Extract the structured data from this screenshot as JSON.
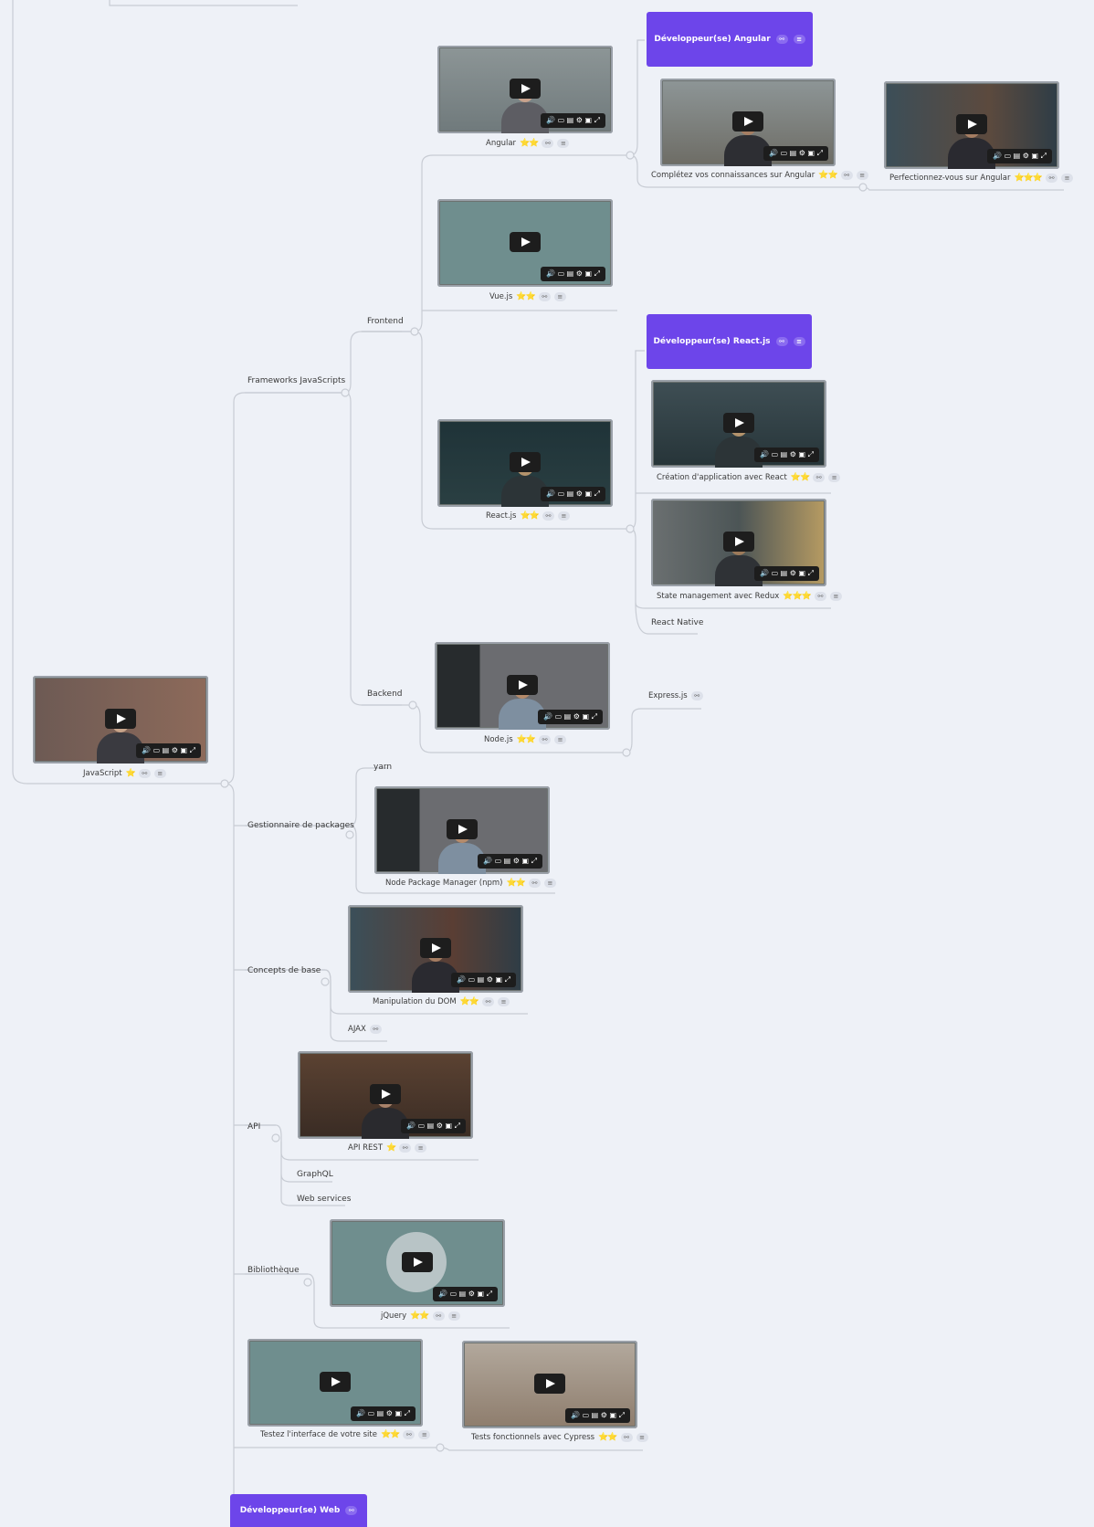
{
  "colors": {
    "accent": "#6d45ea",
    "edge": "#c8ccd4",
    "star": "#e6b800"
  },
  "badges": {
    "angular": "Développeur(se) Angular",
    "react": "Développeur(se) React.js",
    "web": "Développeur(se) Web"
  },
  "labels": {
    "frontend": "Frontend",
    "frameworks": "Frameworks JavaScripts",
    "backend": "Backend",
    "yarn": "yarn",
    "pkg": "Gestionnaire de packages",
    "concepts": "Concepts de base",
    "ajax": "AJAX",
    "api": "API",
    "graphql": "GraphQL",
    "webservices": "Web services",
    "bibliotheque": "Bibliothèque",
    "react_native": "React Native",
    "express": "Express.js"
  },
  "nodes": {
    "angular": {
      "label": "Angular",
      "stars": "⭐⭐"
    },
    "completez": {
      "label": "Complétez  vos connaissances sur Angular",
      "stars": "⭐⭐"
    },
    "perfectionnez": {
      "label": "Perfectionnez-vous sur Angular",
      "stars": "⭐⭐⭐"
    },
    "vue": {
      "label": "Vue.js",
      "stars": "⭐⭐"
    },
    "react": {
      "label": "React.js",
      "stars": "⭐⭐"
    },
    "creation": {
      "label": "Création d'application avec React",
      "stars": "⭐⭐"
    },
    "redux": {
      "label": "State management avec Redux",
      "stars": "⭐⭐⭐"
    },
    "node": {
      "label": "Node.js",
      "stars": "⭐⭐"
    },
    "javascript": {
      "label": "JavaScript",
      "stars": "⭐"
    },
    "npm": {
      "label": "Node Package Manager (npm)",
      "stars": "⭐⭐"
    },
    "dom": {
      "label": "Manipulation du DOM",
      "stars": "⭐⭐"
    },
    "apirest": {
      "label": "API REST",
      "stars": "⭐"
    },
    "jquery": {
      "label": "jQuery",
      "stars": "⭐⭐"
    },
    "testez": {
      "label": "Testez l'interface de votre site",
      "stars": "⭐⭐"
    },
    "cypress": {
      "label": "Tests fonctionnels avec Cypress",
      "stars": "⭐⭐"
    }
  },
  "icons": {
    "link": "link-icon",
    "notes": "notes-icon",
    "play": "play-icon"
  }
}
